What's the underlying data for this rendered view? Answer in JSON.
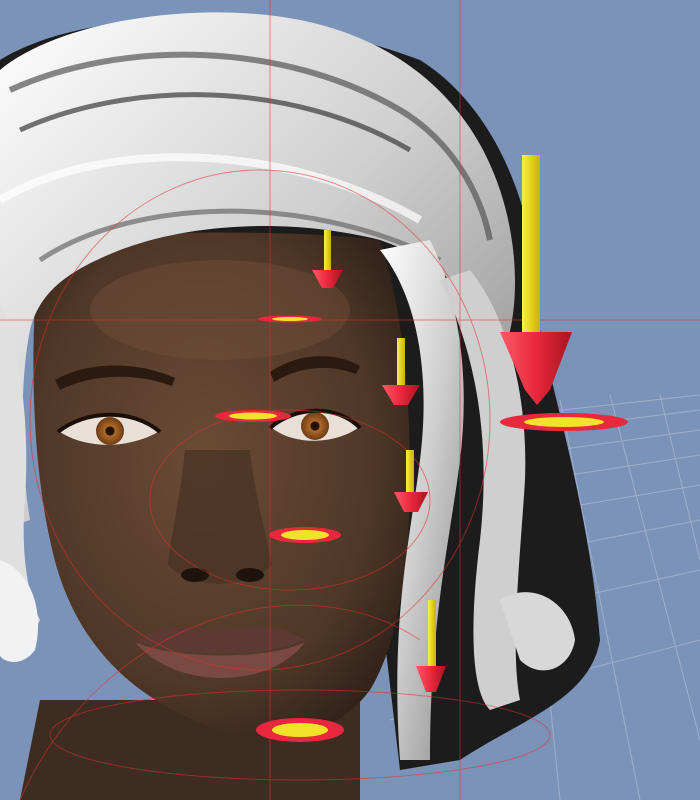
{
  "viewport": {
    "background_color": "#7b93b8",
    "grid_color": "#9aa7c4",
    "guide_color": "#e03030",
    "subject": "3d-figure-head"
  },
  "colors": {
    "skin": "#5a3f2e",
    "skin_shadow": "#3a281d",
    "hair": "#e6e6e6",
    "hair_dark": "#4a4a4a",
    "handle_red": "#e8283c",
    "handle_yellow": "#f2e22a",
    "iris": "#9a5a24"
  },
  "handles": [
    {
      "id": "hair-top-large",
      "kind": "translate-pin"
    },
    {
      "id": "hair-top-small",
      "kind": "translate-pin"
    },
    {
      "id": "brow-disc",
      "kind": "rotate-disc"
    },
    {
      "id": "eyes-disc",
      "kind": "rotate-disc"
    },
    {
      "id": "temple-pin",
      "kind": "translate-pin"
    },
    {
      "id": "cheek-pin",
      "kind": "translate-pin"
    },
    {
      "id": "nose-disc",
      "kind": "rotate-disc"
    },
    {
      "id": "jaw-pin",
      "kind": "translate-pin"
    },
    {
      "id": "chin-disc",
      "kind": "rotate-disc"
    },
    {
      "id": "side-ring",
      "kind": "rotate-disc"
    }
  ]
}
